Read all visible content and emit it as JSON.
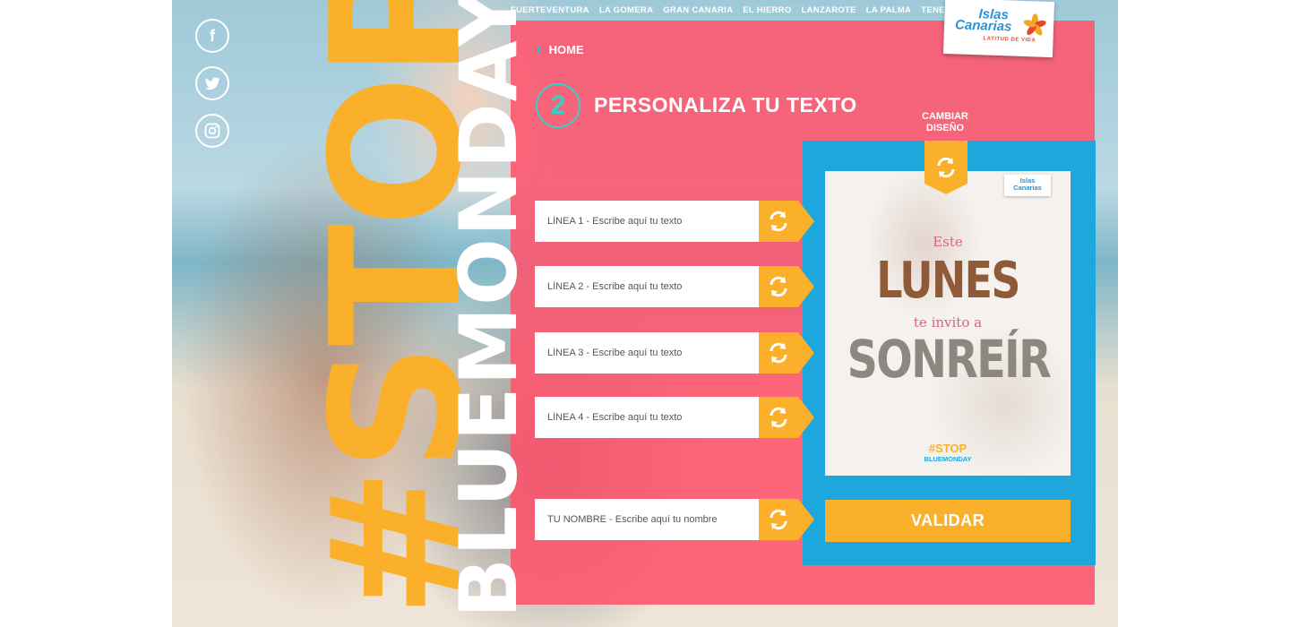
{
  "colors": {
    "accent_yellow": "#fbb02b",
    "panel_pink": "#ff546c",
    "frame_blue": "#1ea7dc",
    "step_teal": "#35d1c6"
  },
  "topnav": [
    "FUERTEVENTURA",
    "LA GOMERA",
    "GRAN CANARIA",
    "EL HIERRO",
    "LANZAROTE",
    "LA PALMA",
    "TENERIFE"
  ],
  "social": [
    {
      "icon": "facebook-icon",
      "glyph": "f"
    },
    {
      "icon": "twitter-icon"
    },
    {
      "icon": "instagram-icon"
    }
  ],
  "hero": {
    "word1": "#STOP",
    "word2": "BLUEMONDAY"
  },
  "brand": {
    "name_line1": "Islas",
    "name_line2": "Canarias",
    "tagline": "LATITUD DE VIDA"
  },
  "home_label": "HOME",
  "step": {
    "number": "2",
    "title": "PERSONALIZA TU TEXTO"
  },
  "fields": [
    {
      "placeholder": "LÍNEA 1 - Escribe aquí tu texto"
    },
    {
      "placeholder": "LÍNEA 2 - Escribe aquí tu texto"
    },
    {
      "placeholder": "LÍNEA 3 - Escribe aquí tu texto"
    },
    {
      "placeholder": "LÍNEA 4 - Escribe aquí tu texto"
    },
    {
      "placeholder": "TU NOMBRE - Escribe aquí tu nombre"
    }
  ],
  "change_design_label": "CAMBIAR DISEÑO",
  "preview": {
    "line1": "Este",
    "line2": "LUNES",
    "line3": "te invito a",
    "line4": "SONREÍR",
    "hashtag1": "#STOP",
    "hashtag2": "BLUEMONDAY",
    "logo_line1": "Islas",
    "logo_line2": "Canarias"
  },
  "validate_label": "VALIDAR"
}
